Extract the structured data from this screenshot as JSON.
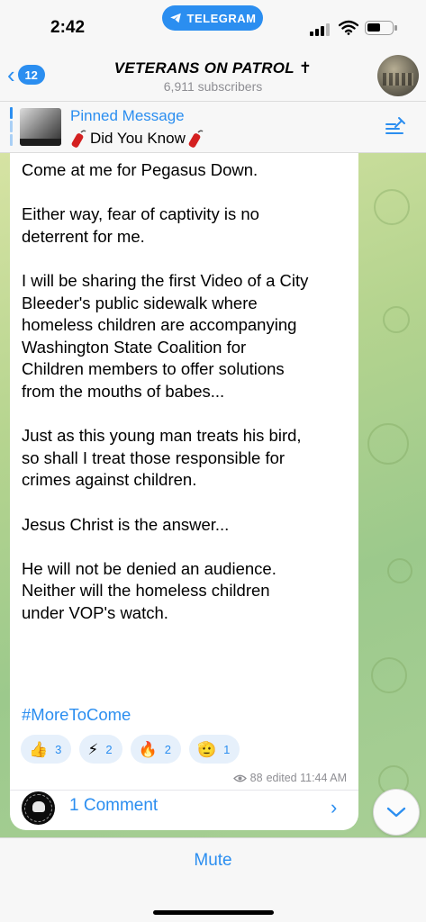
{
  "status": {
    "time": "2:42",
    "pill_label": "TELEGRAM"
  },
  "header": {
    "back_count": "12",
    "title": "VETERANS ON PATROL ✝",
    "subscribers": "6,911 subscribers"
  },
  "pinned": {
    "label": "Pinned Message",
    "text": "Did You Know"
  },
  "message": {
    "text": "Come at me for Pegasus Down.\n\nEither way, fear of captivity is no\ndeterrent for me.\n\nI will be sharing the first Video of a City\nBleeder's public sidewalk where\nhomeless children are accompanying\nWashington State Coalition for\nChildren members to offer solutions\nfrom the mouths of babes...\n\nJust as this young man treats his bird,\nso shall I treat those responsible for\ncrimes against children.\n\nJesus Christ is the answer...\n\nHe will not be denied an audience.\nNeither will the homeless children\nunder VOP's watch.",
    "hashtag": "#MoreToCome",
    "reactions": [
      {
        "emoji": "👍",
        "count": "3"
      },
      {
        "emoji": "⚡",
        "count": "2"
      },
      {
        "emoji": "🔥",
        "count": "2"
      },
      {
        "emoji": "🫡",
        "count": "1"
      }
    ],
    "views": "88",
    "edited_time": "edited 11:44 AM"
  },
  "comments": {
    "label": "1 Comment"
  },
  "bottom": {
    "mute_label": "Mute"
  },
  "colors": {
    "accent": "#2b8ef0",
    "reaction_bg": "#e6f0fb",
    "meta_gray": "#8e8e93"
  }
}
